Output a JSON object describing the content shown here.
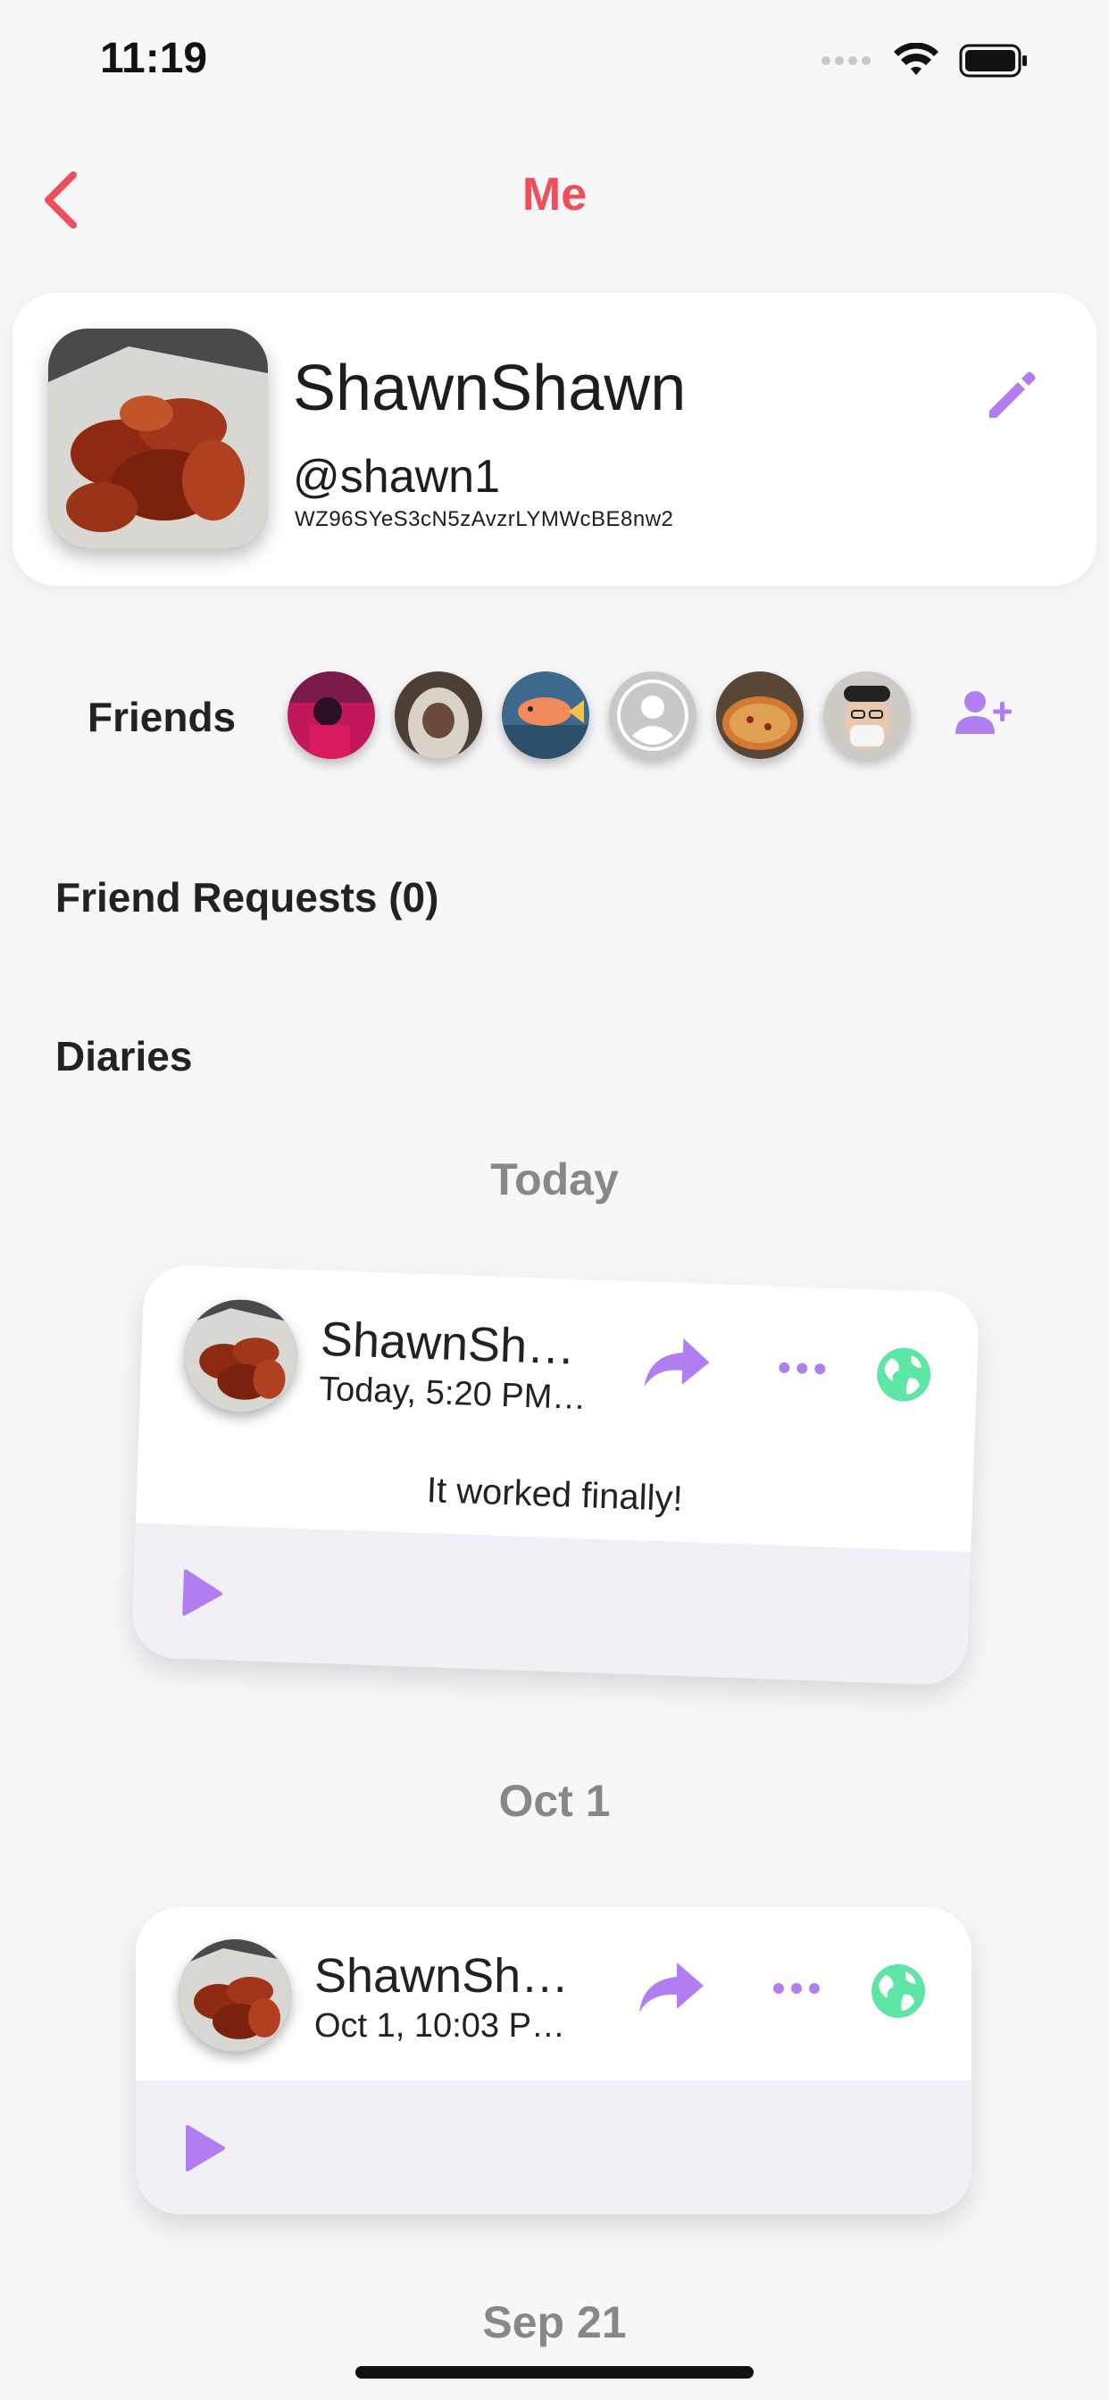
{
  "status_bar": {
    "time": "11:19"
  },
  "nav": {
    "title": "Me"
  },
  "profile": {
    "name": "ShawnShawn",
    "handle": "@shawn1",
    "uid": "WZ96SYeS3cN5zAvzrLYMWcBE8nw2"
  },
  "friends": {
    "label": "Friends"
  },
  "friend_requests": {
    "label": "Friend Requests (0)"
  },
  "diaries": {
    "label": "Diaries",
    "groups": [
      {
        "date": "Today",
        "entry": {
          "name": "ShawnSha...",
          "time": "Today, 5:20 PM ...",
          "text": "It worked finally!"
        }
      },
      {
        "date": "Oct 1",
        "entry": {
          "name": "ShawnSha...",
          "time": "Oct 1, 10:03 PM..."
        }
      },
      {
        "date": "Sep 21"
      }
    ]
  },
  "colors": {
    "accent": "#ef4f5a",
    "purple": "#b07ef0",
    "green": "#5ee6a6"
  }
}
